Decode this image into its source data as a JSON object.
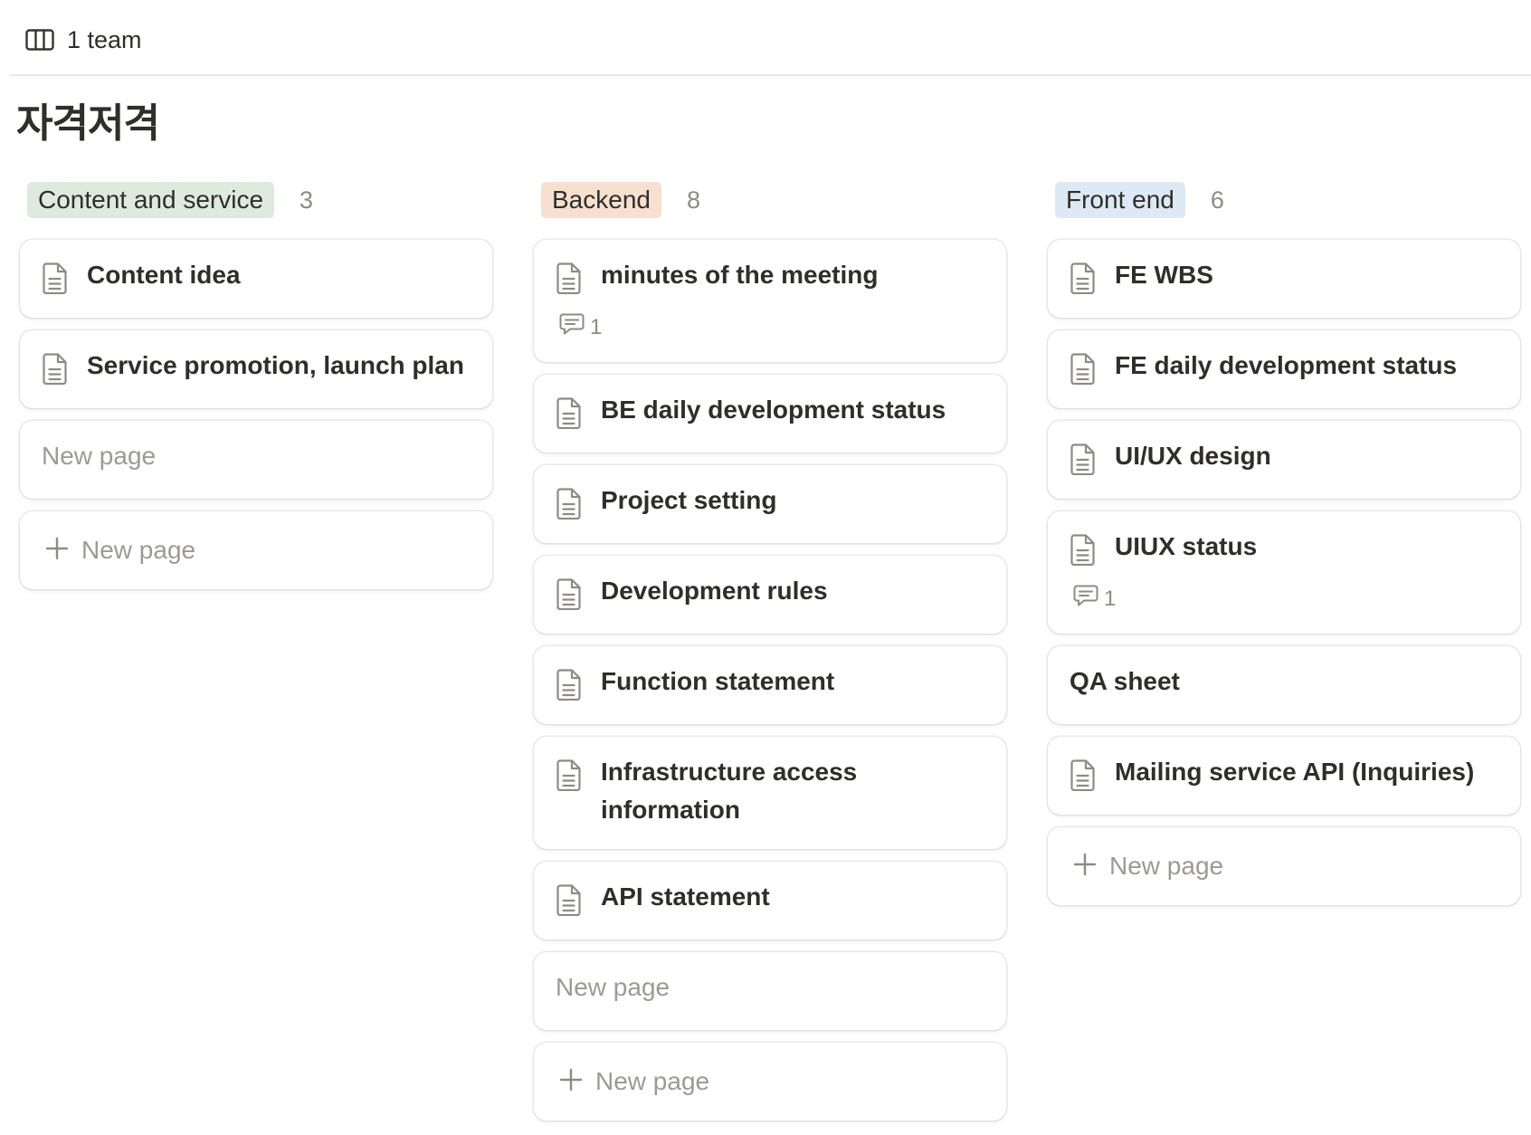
{
  "view": {
    "label": "1 team",
    "icon": "table-columns-icon"
  },
  "page_title": "자격저격",
  "groups": [
    {
      "label": "Content and service",
      "count": "3",
      "tag_color": "#dfeadf",
      "cards": [
        {
          "title": "Content idea"
        },
        {
          "title": "Service promotion, launch plan"
        },
        {
          "title": "New page"
        }
      ],
      "new_page_label": "New page"
    },
    {
      "label": "Backend",
      "count": "8",
      "tag_color": "#f7e0d2",
      "cards": [
        {
          "title": "minutes of the meeting",
          "comments": "1"
        },
        {
          "title": "BE daily development status"
        },
        {
          "title": "Project setting"
        },
        {
          "title": "Development rules"
        },
        {
          "title": "Function statement"
        },
        {
          "title": "Infrastructure access information"
        },
        {
          "title": "API statement"
        },
        {
          "title": "New page"
        }
      ],
      "new_page_label": "New page"
    },
    {
      "label": "Front end",
      "count": "6",
      "tag_color": "#dde9f5",
      "cards": [
        {
          "title": "FE WBS"
        },
        {
          "title": "FE daily development status"
        },
        {
          "title": "UI/UX design"
        },
        {
          "title": "UIUX status",
          "comments": "1"
        },
        {
          "title": "QA sheet"
        },
        {
          "title": "Mailing service API (Inquiries)"
        }
      ],
      "new_page_label": "New page"
    }
  ]
}
